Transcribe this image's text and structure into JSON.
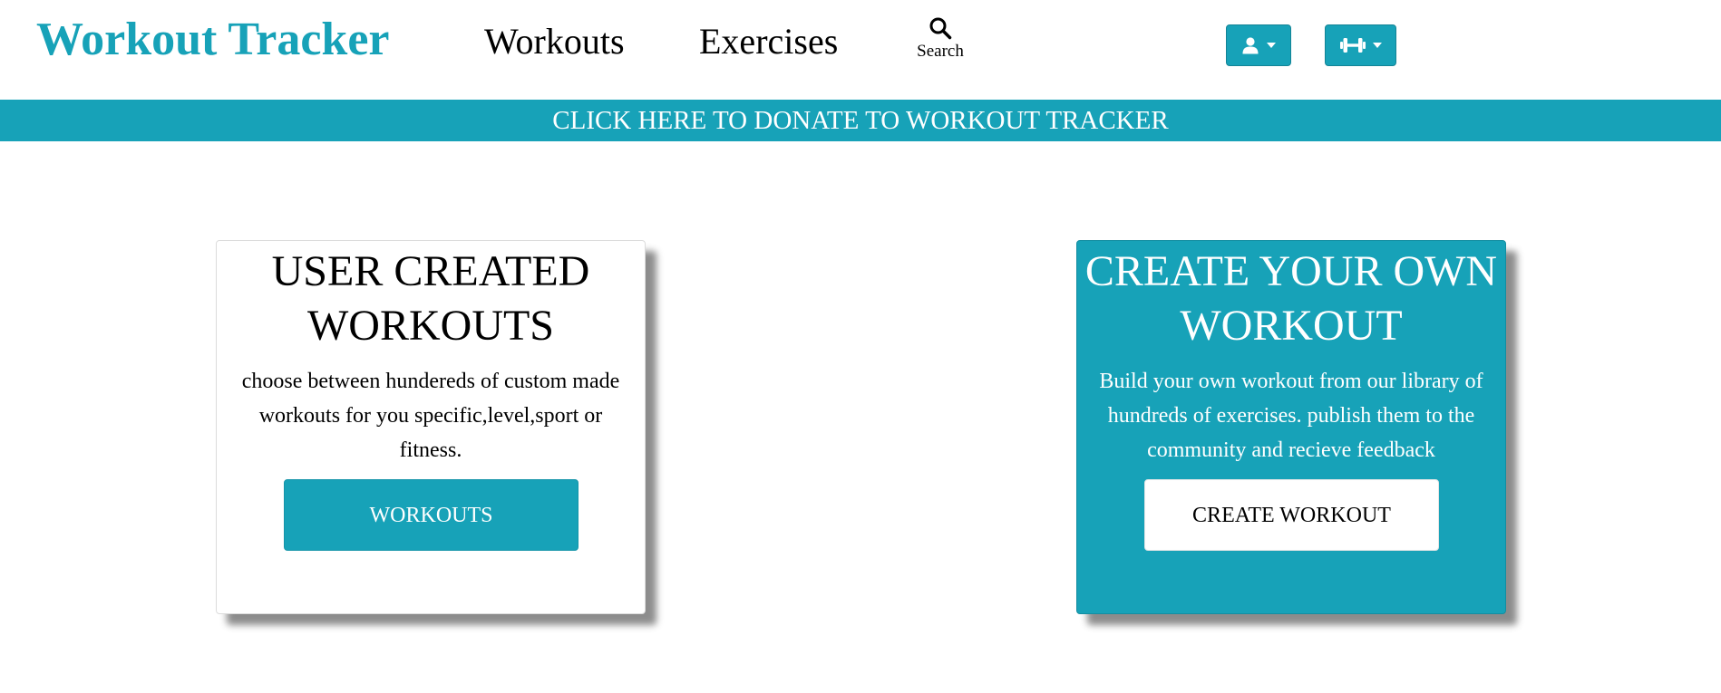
{
  "navbar": {
    "brand": "Workout Tracker",
    "links": {
      "workouts": "Workouts",
      "exercises": "Exercises"
    },
    "search_label": "Search",
    "user_menu_icon": "user-icon",
    "gym_menu_icon": "dumbbell-icon"
  },
  "donate_banner": {
    "text": "CLICK HERE TO DONATE TO WORKOUT TRACKER"
  },
  "cards": {
    "user_workouts": {
      "title": "USER CREATED WORKOUTS",
      "text": "choose between hundereds of custom made workouts for you specific,level,sport or fitness.",
      "button": "WORKOUTS"
    },
    "create_workout": {
      "title": "CREATE YOUR OWN WORKOUT",
      "text": "Build your own workout from our library of hundreds of exercises. publish them to the community and recieve feedback",
      "button": "CREATE WORKOUT"
    }
  },
  "colors": {
    "accent": "#17a2b8",
    "background": "#ffffff",
    "text": "#000000"
  }
}
